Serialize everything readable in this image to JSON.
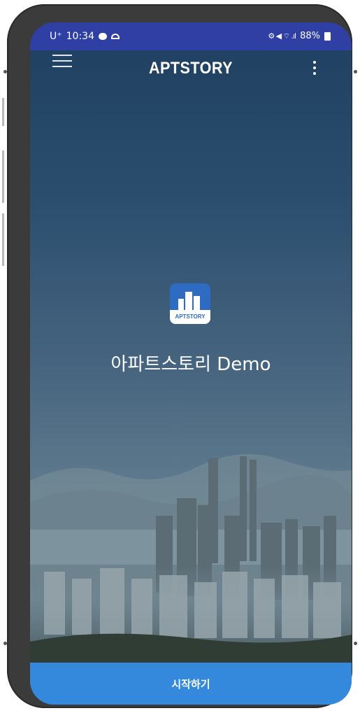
{
  "status_bar": {
    "carrier": "U⁺",
    "time": "10:34",
    "right_icons": "⚙ ◀ ⌔ .ıl",
    "battery": "88%"
  },
  "app_bar": {
    "title": "APTSTORY",
    "menu_icon": "hamburger-icon",
    "more_icon": "more-vertical-icon"
  },
  "splash": {
    "logo_text": "APTSTORY",
    "app_name": "아파트스토리 Demo"
  },
  "footer": {
    "start_label": "시작하기"
  },
  "colors": {
    "status_bar": "#2f3fa4",
    "start_button": "#3489dc",
    "logo_bg": "#2d6cc2"
  }
}
